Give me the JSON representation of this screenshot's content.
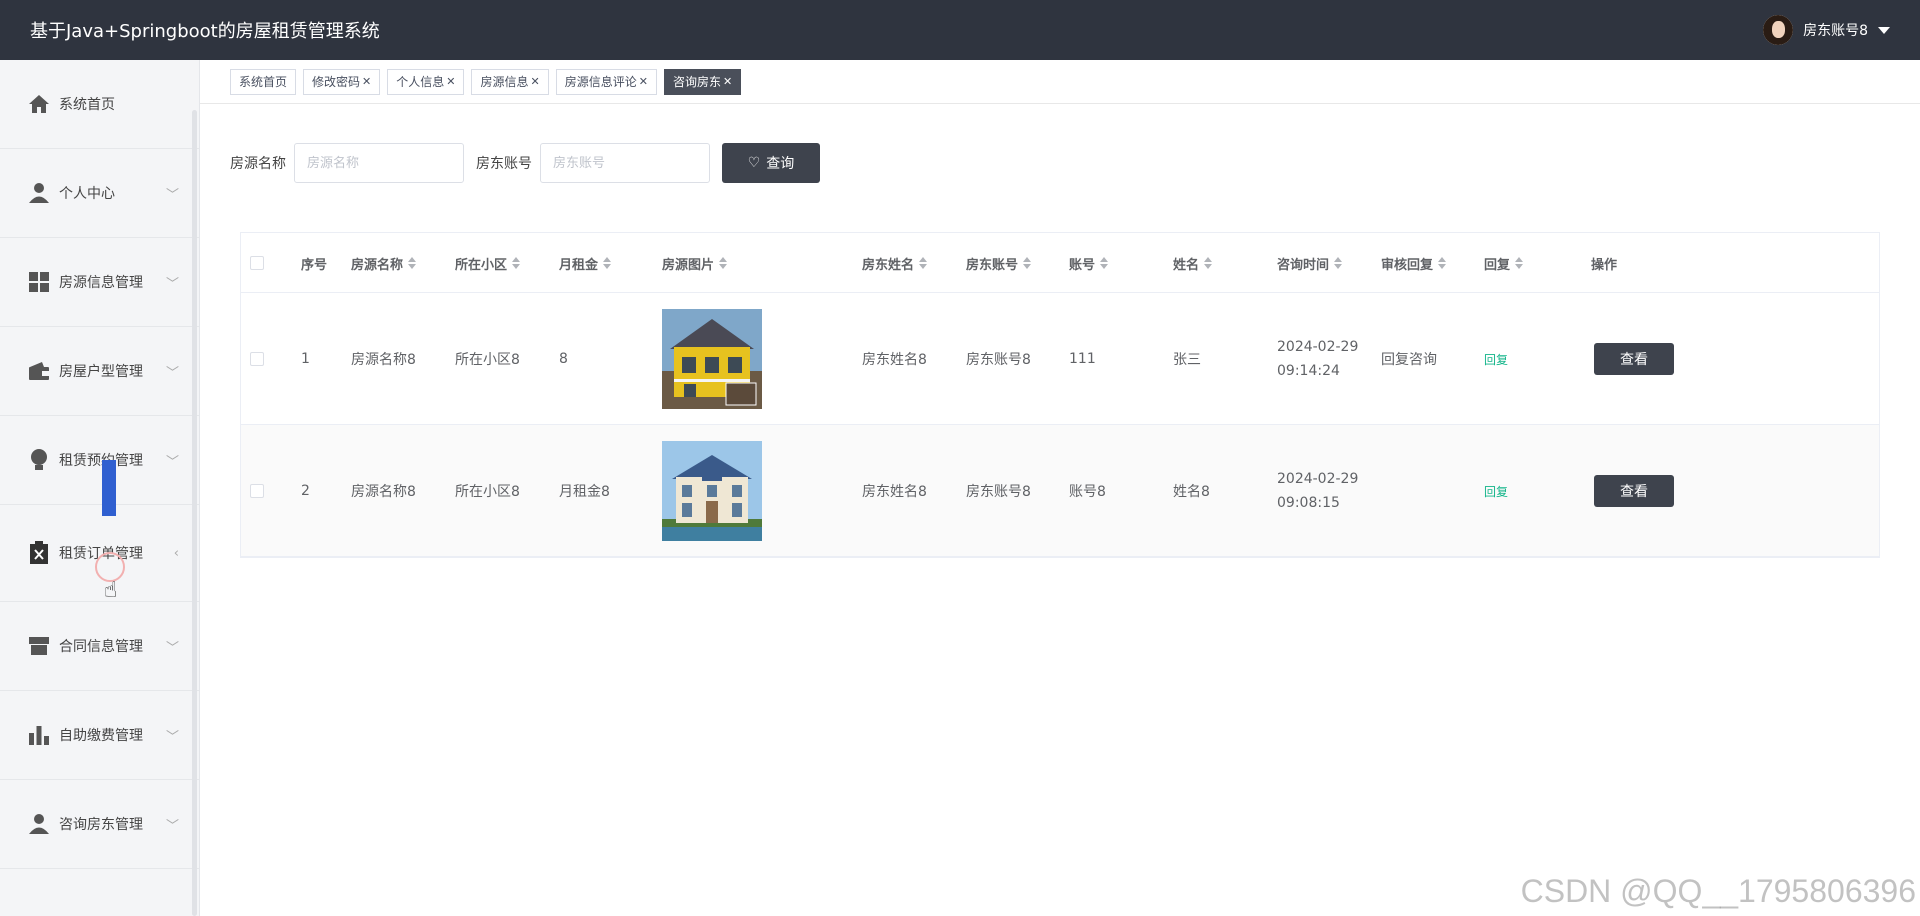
{
  "header": {
    "title": "基于Java+Springboot的房屋租赁管理系统",
    "user": "房东账号8"
  },
  "sidebar": {
    "items": [
      {
        "label": "系统首页",
        "icon": "home-icon"
      },
      {
        "label": "个人中心",
        "icon": "user-icon"
      },
      {
        "label": "房源信息管理",
        "icon": "grid-icon"
      },
      {
        "label": "房屋户型管理",
        "icon": "wallet-icon"
      },
      {
        "label": "租赁预约管理",
        "icon": "bulb-icon"
      },
      {
        "label": "租赁订单管理",
        "icon": "clipboard-x-icon"
      },
      {
        "label": "合同信息管理",
        "icon": "store-icon"
      },
      {
        "label": "自助缴费管理",
        "icon": "bar-chart-icon"
      },
      {
        "label": "咨询房东管理",
        "icon": "person-icon"
      }
    ]
  },
  "tabs": [
    {
      "label": "系统首页",
      "closable": false
    },
    {
      "label": "修改密码",
      "closable": true
    },
    {
      "label": "个人信息",
      "closable": true
    },
    {
      "label": "房源信息",
      "closable": true
    },
    {
      "label": "房源信息评论",
      "closable": true
    },
    {
      "label": "咨询房东",
      "closable": true,
      "active": true
    }
  ],
  "search": {
    "house_name_label": "房源名称",
    "house_name_placeholder": "房源名称",
    "landlord_account_label": "房东账号",
    "landlord_account_placeholder": "房东账号",
    "button_label": "查询"
  },
  "table": {
    "headers": [
      "序号",
      "房源名称",
      "所在小区",
      "月租金",
      "房源图片",
      "房东姓名",
      "房东账号",
      "账号",
      "姓名",
      "咨询时间",
      "审核回复",
      "回复",
      "操作"
    ],
    "rows": [
      {
        "index": "1",
        "house_name": "房源名称8",
        "community": "所在小区8",
        "rent": "8",
        "landlord_name": "房东姓名8",
        "landlord_account": "房东账号8",
        "account": "111",
        "name": "张三",
        "date": "2024-02-29",
        "time": "09:14:24",
        "review_reply": "回复咨询",
        "reply": "回复",
        "action": "查看"
      },
      {
        "index": "2",
        "house_name": "房源名称8",
        "community": "所在小区8",
        "rent": "月租金8",
        "landlord_name": "房东姓名8",
        "landlord_account": "房东账号8",
        "account": "账号8",
        "name": "姓名8",
        "date": "2024-02-29",
        "time": "09:08:15",
        "review_reply": "",
        "reply": "回复",
        "action": "查看"
      }
    ]
  },
  "watermark": "CSDN @QQ__1795806396",
  "colors": {
    "topbar": "#2f343f",
    "accent_dark": "#3e434d",
    "reply_green": "#13b58a",
    "active_tab": "#4a4f5a"
  }
}
